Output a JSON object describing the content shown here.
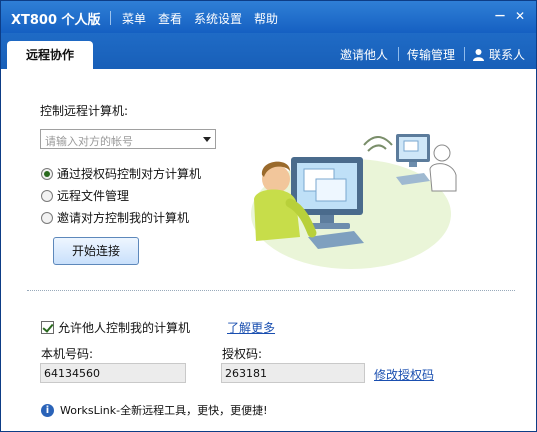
{
  "titlebar": {
    "title": "XT800 个人版",
    "menu": [
      "菜单",
      "查看",
      "系统设置",
      "帮助"
    ],
    "minimize": "－",
    "close": "✕"
  },
  "tabs": {
    "active": "远程协作",
    "invite": "邀请他人",
    "transfer": "传输管理",
    "contacts": "联系人"
  },
  "control": {
    "label": "控制远程计算机:",
    "account_placeholder": "请输入对方的帐号",
    "options": [
      {
        "label": "通过授权码控制对方计算机",
        "selected": true
      },
      {
        "label": "远程文件管理",
        "selected": false
      },
      {
        "label": "邀请对方控制我的计算机",
        "selected": false
      }
    ],
    "connect_button": "开始连接"
  },
  "permission": {
    "allow_label": "允许他人控制我的计算机",
    "allow_checked": true,
    "learn_more": "了解更多",
    "machine_code_label": "本机号码:",
    "machine_code": "64134560",
    "auth_code_label": "授权码:",
    "auth_code": "263181",
    "change_auth": "修改授权码"
  },
  "footer": {
    "info": "WorksLink-全新远程工具，更快，更便捷!"
  }
}
